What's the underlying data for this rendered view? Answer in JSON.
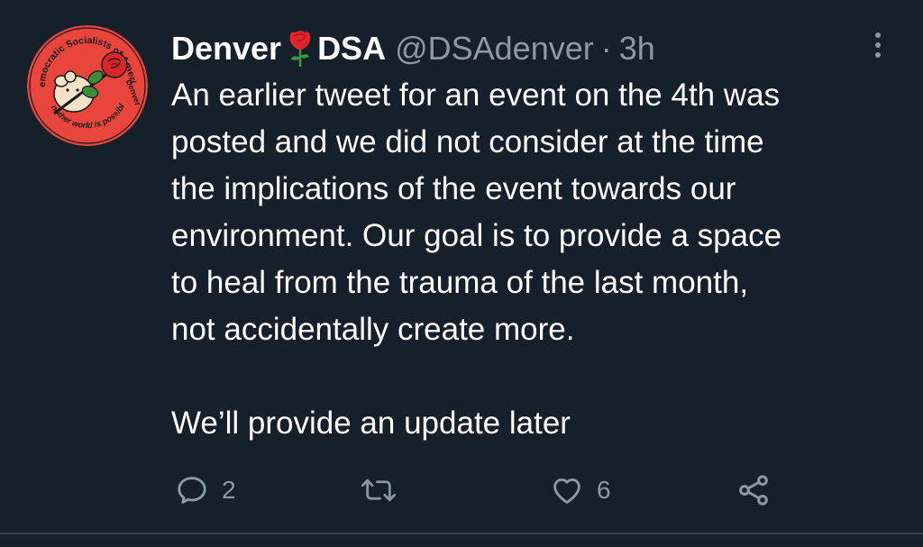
{
  "tweet": {
    "display_name": "Denver",
    "display_name_suffix": "DSA",
    "handle": "@DSAdenver",
    "separator": "·",
    "time": "3h",
    "paragraphs": [
      [
        "An earlier tweet for an event on the 4th was",
        "posted and we did not consider at the time",
        "the implications of the event towards our",
        "environment.  Our goal is to provide a space",
        "to heal from the trauma of the last month,",
        "not accidentally create more."
      ],
      [
        "We’ll provide an update later"
      ]
    ],
    "avatar": {
      "text_top": "Democratic Socialists of America",
      "text_right": "Denver",
      "text_bottom": "Another world is possible",
      "bg_color": "#e8453c"
    },
    "actions": {
      "reply_count": "2",
      "retweet_count": "",
      "like_count": "6"
    }
  },
  "icons": {
    "reply": "speech-bubble-icon",
    "retweet": "retweet-arrows-icon",
    "like": "heart-icon",
    "share": "share-nodes-icon",
    "more": "vertical-ellipsis-icon",
    "rose": "rose-emoji"
  },
  "colors": {
    "background": "#15202b",
    "primary_text": "#ffffff",
    "secondary_text": "#8b98a5",
    "divider": "#38444d",
    "rose_red": "#e0242c"
  }
}
